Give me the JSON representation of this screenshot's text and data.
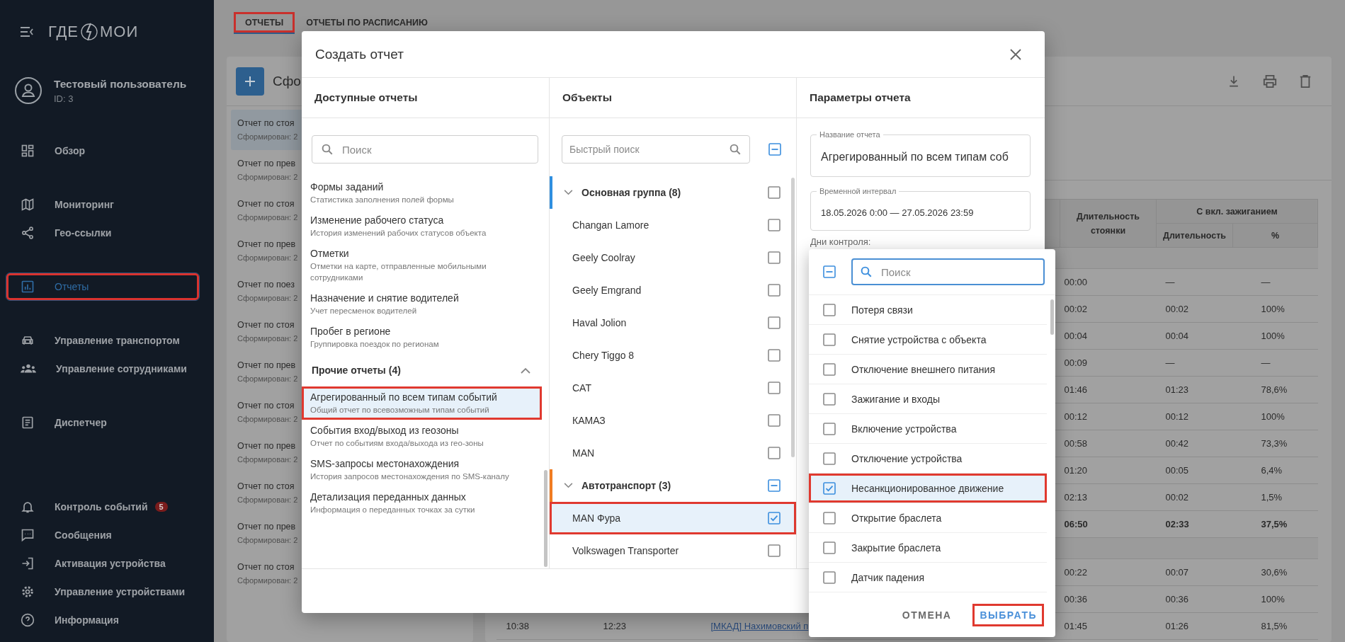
{
  "sidebar": {
    "logo_left": "ГДЕ",
    "logo_right": "МОИ",
    "user": {
      "name": "Тестовый пользователь",
      "id": "ID: 3"
    },
    "sections": [
      {
        "items": [
          {
            "label": "Обзор",
            "selected": false,
            "highlighted": false
          }
        ]
      },
      {
        "items": [
          {
            "label": "Мониторинг",
            "selected": false,
            "highlighted": false
          },
          {
            "label": "Гео-ссылки",
            "selected": false,
            "highlighted": false
          }
        ]
      },
      {
        "items": [
          {
            "label": "Отчеты",
            "selected": true,
            "highlighted": true
          }
        ]
      },
      {
        "items": [
          {
            "label": "Управление транспортом",
            "selected": false,
            "highlighted": false
          },
          {
            "label": "Управление сотрудниками",
            "selected": false,
            "highlighted": false
          }
        ]
      },
      {
        "items": [
          {
            "label": "Диспетчер",
            "selected": false,
            "highlighted": false
          }
        ]
      },
      {
        "items": [
          {
            "label": "Контроль событий",
            "badge": "5",
            "selected": false,
            "highlighted": false
          },
          {
            "label": "Сообщения",
            "selected": false,
            "highlighted": false
          },
          {
            "label": "Активация устройства",
            "selected": false,
            "highlighted": false
          },
          {
            "label": "Управление устройствами",
            "selected": false,
            "highlighted": false
          },
          {
            "label": "Информация",
            "selected": false,
            "highlighted": false
          }
        ]
      }
    ]
  },
  "tabs": [
    {
      "label": "ОТЧЕТЫ",
      "selected": true,
      "highlighted": true
    },
    {
      "label": "ОТЧЕТЫ ПО РАСПИСАНИЮ",
      "selected": false,
      "highlighted": false
    }
  ],
  "reports_panel": {
    "title": "Сфо",
    "items": [
      {
        "title": "Отчет по стоя",
        "subtitle": "Сформирован: 2",
        "selected": true
      },
      {
        "title": "Отчет по прев",
        "subtitle": "Сформирован: 2",
        "selected": false
      },
      {
        "title": "Отчет по стоя",
        "subtitle": "Сформирован: 2",
        "selected": false
      },
      {
        "title": "Отчет по прев",
        "subtitle": "Сформирован: 2",
        "selected": false
      },
      {
        "title": "Отчет по поез",
        "subtitle": "Сформирован: 2",
        "selected": false
      },
      {
        "title": "Отчет по стоя",
        "subtitle": "Сформирован: 2",
        "selected": false
      },
      {
        "title": "Отчет по прев",
        "subtitle": "Сформирован: 2",
        "selected": false
      },
      {
        "title": "Отчет по стоя",
        "subtitle": "Сформирован: 2",
        "selected": false
      },
      {
        "title": "Отчет по прев",
        "subtitle": "Сформирован: 2",
        "selected": false
      },
      {
        "title": "Отчет по стоя",
        "subtitle": "Сформирован: 2",
        "selected": false
      },
      {
        "title": "Отчет по прев",
        "subtitle": "Сформирован: 2",
        "selected": false
      },
      {
        "title": "Отчет по стоя",
        "subtitle": "Сформирован: 2",
        "selected": false
      }
    ]
  },
  "report_table": {
    "parking_header": "Длительность стоянки",
    "ignition_header": "С вкл. зажиганием",
    "ignition_columns": [
      "Длительность",
      "%"
    ],
    "rows": [
      {
        "kind": "group"
      },
      {
        "kind": "data",
        "cells": [
          "00:00",
          "—",
          "—"
        ]
      },
      {
        "kind": "data",
        "cells": [
          "00:02",
          "00:02",
          "100%"
        ]
      },
      {
        "kind": "data",
        "cells": [
          "00:04",
          "00:04",
          "100%"
        ]
      },
      {
        "kind": "data",
        "cells": [
          "00:09",
          "—",
          "—"
        ]
      },
      {
        "kind": "data",
        "cells": [
          "01:46",
          "01:23",
          "78,6%"
        ]
      },
      {
        "kind": "data",
        "cells": [
          "00:12",
          "00:12",
          "100%"
        ]
      },
      {
        "kind": "data",
        "cells": [
          "00:58",
          "00:42",
          "73,3%"
        ]
      },
      {
        "kind": "data",
        "cells": [
          "01:20",
          "00:05",
          "6,4%"
        ]
      },
      {
        "kind": "data",
        "cells": [
          "02:13",
          "00:02",
          "1,5%"
        ]
      },
      {
        "kind": "total",
        "cells": [
          "06:50",
          "02:33",
          "37,5%"
        ]
      },
      {
        "kind": "group"
      },
      {
        "kind": "data",
        "cells": [
          "00:22",
          "00:07",
          "30,6%"
        ]
      },
      {
        "kind": "data",
        "cells": [
          "00:36",
          "00:36",
          "100%"
        ]
      },
      {
        "kind": "data",
        "cells": [
          "10:38",
          "12:23",
          "[МКАД] Нахимовский п",
          "01:45",
          "01:26",
          "81,5%"
        ]
      }
    ]
  },
  "modal": {
    "title": "Создать отчет",
    "reports": {
      "heading": "Доступные отчеты",
      "search_placeholder": "Поиск",
      "items": [
        {
          "kind": "report",
          "title": "Формы заданий",
          "description": "Статистика заполнения полей формы",
          "selected": false,
          "highlighted": false
        },
        {
          "kind": "report",
          "title": "Изменение рабочего статуса",
          "description": "История изменений рабочих статусов объекта",
          "selected": false,
          "highlighted": false
        },
        {
          "kind": "report",
          "title": "Отметки",
          "description": "Отметки на карте, отправленные мобильными сотрудниками",
          "selected": false,
          "highlighted": false
        },
        {
          "kind": "report",
          "title": "Назначение и снятие водителей",
          "description": "Учет пересменок водителей",
          "selected": false,
          "highlighted": false
        },
        {
          "kind": "report",
          "title": "Пробег в регионе",
          "description": "Группировка поездок по регионам",
          "selected": false,
          "highlighted": false
        },
        {
          "kind": "group",
          "title": "Прочие отчеты (4)",
          "expanded": true
        },
        {
          "kind": "report",
          "title": "Агрегированный по всем типам событий",
          "description": "Общий отчет по всевозможным типам событий",
          "selected": true,
          "highlighted": true
        },
        {
          "kind": "report",
          "title": "События вход/выход из геозоны",
          "description": "Отчет по событиям входа/выхода из гео-зоны",
          "selected": false,
          "highlighted": false
        },
        {
          "kind": "report",
          "title": "SMS-запросы местонахождения",
          "description": "История запросов местонахождения по SMS-каналу",
          "selected": false,
          "highlighted": false
        },
        {
          "kind": "report",
          "title": "Детализация переданных данных",
          "description": "Информация о переданных точках за сутки",
          "selected": false,
          "highlighted": false
        }
      ]
    },
    "objects": {
      "heading": "Объекты",
      "search_placeholder": "Быстрый поиск",
      "select_all": {
        "checked": false,
        "partial": true
      },
      "items": [
        {
          "kind": "group",
          "label": "Основная группа (8)",
          "expanded": true,
          "color": "#2f8fe0",
          "checked": false,
          "partial": false
        },
        {
          "kind": "object",
          "label": "Changan Lamore",
          "checked": false,
          "highlighted": false
        },
        {
          "kind": "object",
          "label": "Geely Coolray",
          "checked": false,
          "highlighted": false
        },
        {
          "kind": "object",
          "label": "Geely Emgrand",
          "checked": false,
          "highlighted": false
        },
        {
          "kind": "object",
          "label": "Haval Jolion",
          "checked": false,
          "highlighted": false
        },
        {
          "kind": "object",
          "label": "Chery Tiggo 8",
          "checked": false,
          "highlighted": false
        },
        {
          "kind": "object",
          "label": "CAT",
          "checked": false,
          "highlighted": false
        },
        {
          "kind": "object",
          "label": "КАМАЗ",
          "checked": false,
          "highlighted": false
        },
        {
          "kind": "object",
          "label": "MAN",
          "checked": false,
          "highlighted": false
        },
        {
          "kind": "group",
          "label": "Автотранспорт (3)",
          "expanded": true,
          "color": "#f07c22",
          "checked": false,
          "partial": true
        },
        {
          "kind": "object",
          "label": "MAN Фура",
          "checked": true,
          "highlighted": true
        },
        {
          "kind": "object",
          "label": "Volkswagen Transporter",
          "checked": false,
          "highlighted": false
        }
      ]
    },
    "parameters": {
      "heading": "Параметры отчета",
      "fields": [
        {
          "label": "Название отчета",
          "value": "Агрегированный по всем типам соб"
        },
        {
          "label": "Временной интервал",
          "value": "18.05.2026 0:00 — 27.05.2026 23:59"
        }
      ],
      "days_label": "Дни контроля:"
    }
  },
  "days_dropdown": {
    "select_all": {
      "checked": false,
      "partial": true
    },
    "search_placeholder": "Поиск",
    "focused": true,
    "items": [
      {
        "label": "Потеря связи",
        "checked": false,
        "highlighted": false
      },
      {
        "label": "Снятие устройства с объекта",
        "checked": false,
        "highlighted": false
      },
      {
        "label": "Отключение внешнего питания",
        "checked": false,
        "highlighted": false
      },
      {
        "label": "Зажигание и входы",
        "checked": false,
        "highlighted": false
      },
      {
        "label": "Включение устройства",
        "checked": false,
        "highlighted": false
      },
      {
        "label": "Отключение устройства",
        "checked": false,
        "highlighted": false
      },
      {
        "label": "Несанкционированное движение",
        "checked": true,
        "highlighted": true
      },
      {
        "label": "Открытие браслета",
        "checked": false,
        "highlighted": false
      },
      {
        "label": "Закрытие браслета",
        "checked": false,
        "highlighted": false
      },
      {
        "label": "Датчик падения",
        "checked": false,
        "highlighted": false
      }
    ],
    "buttons": [
      {
        "kind": "cancel",
        "label": "ОТМЕНА",
        "highlighted": false
      },
      {
        "kind": "confirm",
        "label": "ВЫБРАТЬ",
        "highlighted": true
      }
    ]
  }
}
